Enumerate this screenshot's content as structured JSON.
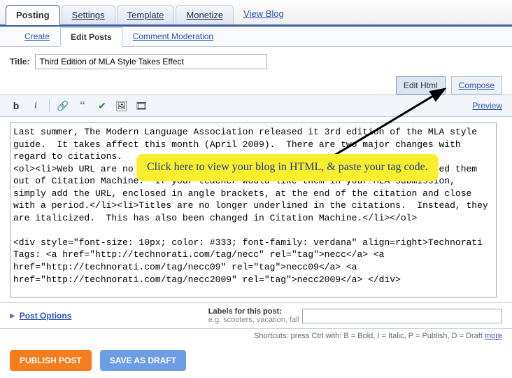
{
  "tabs": {
    "posting": "Posting",
    "settings": "Settings",
    "template": "Template",
    "monetize": "Monetize",
    "view_blog": "View Blog"
  },
  "subtabs": {
    "create": "Create",
    "edit_posts": "Edit Posts",
    "comment_mod": "Comment Moderation"
  },
  "title": {
    "label": "Title:",
    "value": "Third Edition of MLA Style Takes Effect"
  },
  "mode": {
    "edit_html": "Edit Html",
    "compose": "Compose",
    "preview": "Preview"
  },
  "toolbar": {
    "bold": "b",
    "italic": "i"
  },
  "editor_text": "Last summer, The Modern Language Association released it 3rd edition of the MLA style guide.  It takes affect this month (April 2009).  There are two major changes with regard to citations.\n<ol><li>Web URL are no longer included in standard citations.  I have programmed them out of Citation Machine.  If your teacher would like them in your MLA submission, simply add the URL, enclosed in angle brackets, at the end of the citation and close with a period.</li><li>Titles are no longer underlined in the citations.  Instead, they are italicized.  This has also been changed in Citation Machine.</li></ol>\n\n<div style=\"font-size: 10px; color: #333; font-family: verdana\" align=right>Technorati Tags: <a href=\"http://technorati.com/tag/necc\" rel=\"tag\">necc</a> <a href=\"http://technorati.com/tag/necc09\" rel=\"tag\">necc09</a> <a href=\"http://technorati.com/tag/necc2009\" rel=\"tag\">necc2009</a> </div>",
  "callout": "Click here to view your blog in HTML, & paste your tag code.",
  "post_options": "Post Options",
  "labels": {
    "label": "Labels for this post:",
    "eg": "e.g. scooters, vacation, fall"
  },
  "shortcuts": {
    "text": "Shortcuts: press Ctrl with: B = Bold, I = Italic, P = Publish, D = Draft ",
    "more": "more"
  },
  "buttons": {
    "publish": "PUBLISH POST",
    "draft": "SAVE AS DRAFT"
  }
}
